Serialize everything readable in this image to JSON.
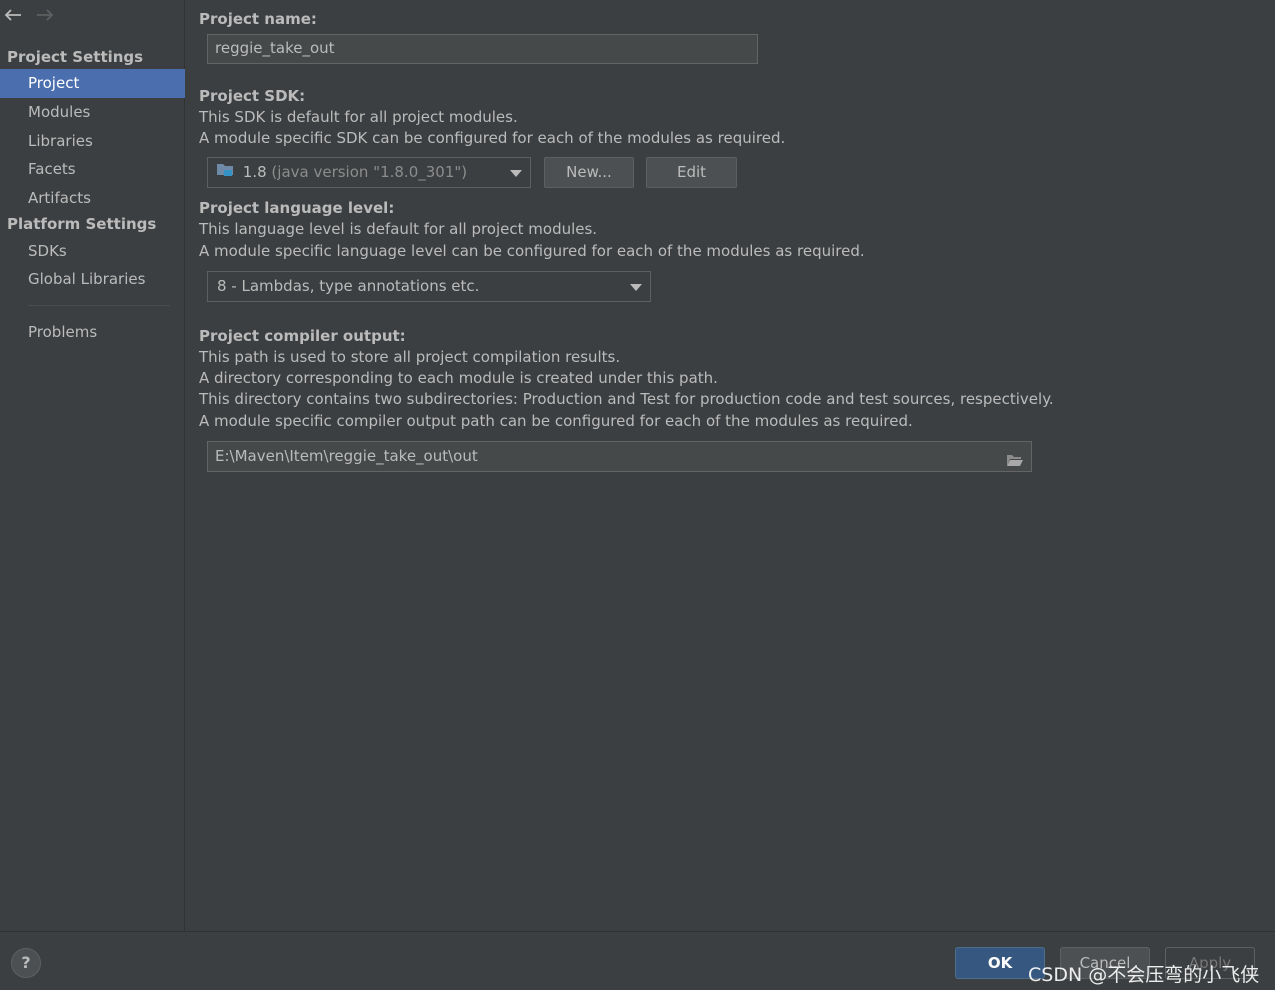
{
  "sidebar": {
    "project_settings_header": "Project Settings",
    "project_items": [
      "Project",
      "Modules",
      "Libraries",
      "Facets",
      "Artifacts"
    ],
    "platform_settings_header": "Platform Settings",
    "platform_items": [
      "SDKs",
      "Global Libraries"
    ],
    "problems": "Problems",
    "selected": "Project"
  },
  "main": {
    "project_name_label": "Project name:",
    "project_name_value": "reggie_take_out",
    "sdk_label": "Project SDK:",
    "sdk_desc_1": "This SDK is default for all project modules.",
    "sdk_desc_2": "A module specific SDK can be configured for each of the modules as required.",
    "sdk_value": "1.8",
    "sdk_value_hint": "(java version \"1.8.0_301\")",
    "sdk_new_button": "New...",
    "sdk_edit_button": "Edit",
    "lang_label": "Project language level:",
    "lang_desc_1": "This language level is default for all project modules.",
    "lang_desc_2": "A module specific language level can be configured for each of the modules as required.",
    "lang_value": "8 - Lambdas, type annotations etc.",
    "output_label": "Project compiler output:",
    "output_desc_1": "This path is used to store all project compilation results.",
    "output_desc_2": "A directory corresponding to each module is created under this path.",
    "output_desc_3": "This directory contains two subdirectories: Production and Test for production code and test sources, respectively.",
    "output_desc_4": "A module specific compiler output path can be configured for each of the modules as required.",
    "output_value": "E:\\Maven\\Item\\reggie_take_out\\out"
  },
  "footer": {
    "help": "?",
    "ok": "OK",
    "cancel": "Cancel",
    "apply": "Apply",
    "watermark": "CSDN @不会压弯的小飞侠"
  },
  "colors": {
    "background": "#3c3f41",
    "selection": "#4b6eaf",
    "ok_button": "#365880"
  }
}
